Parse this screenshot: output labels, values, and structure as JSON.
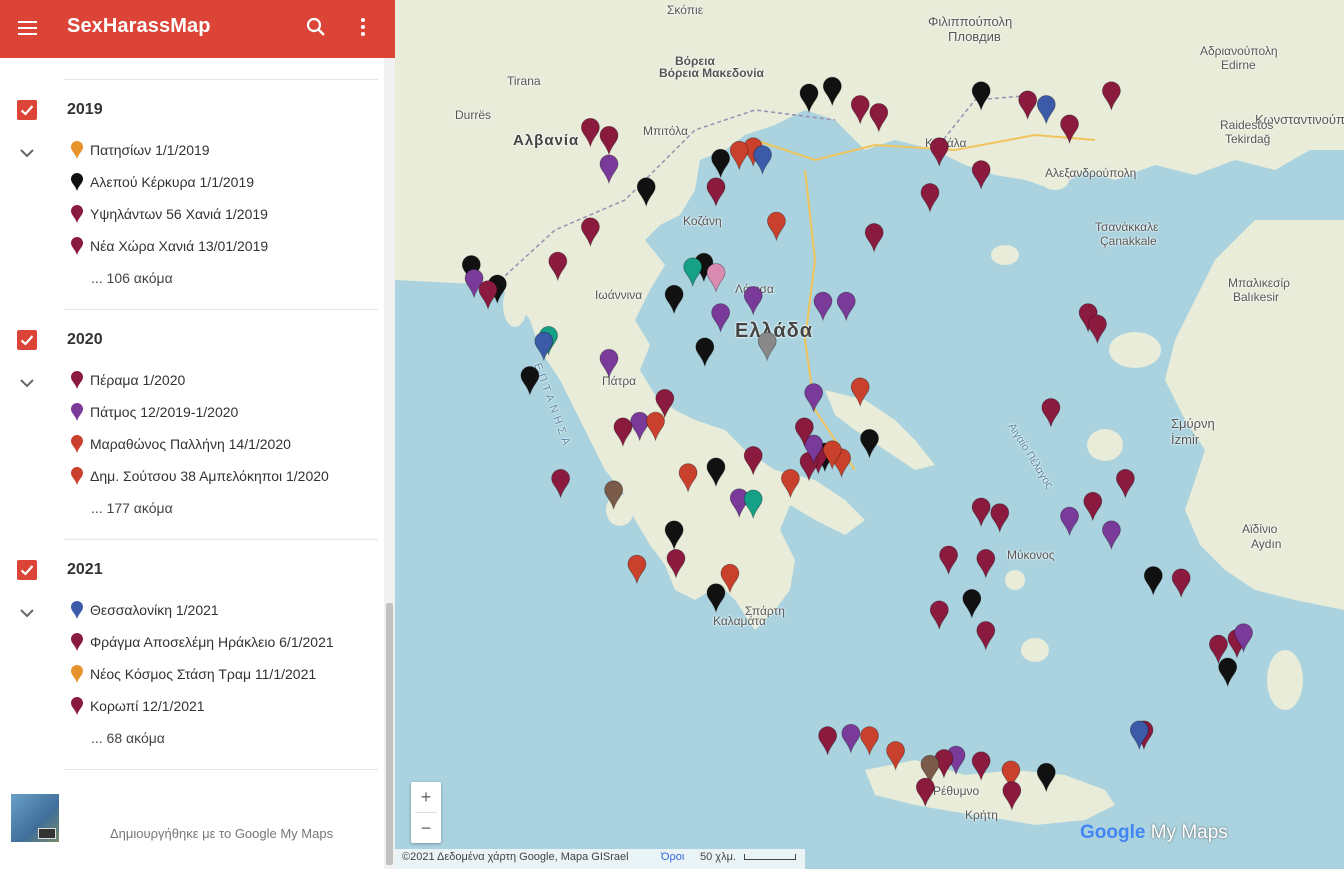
{
  "app": {
    "title": "SexHarassMap"
  },
  "icons": {
    "menu": "menu-icon",
    "search": "search-icon",
    "more": "more-vert-icon"
  },
  "colors": {
    "header": "#db4437",
    "water": "#aad3df",
    "land": "#e8ecd9"
  },
  "layers": [
    {
      "title": "2019",
      "items": [
        {
          "label": "Πατησίων 1/1/2019",
          "color": "#e8922c"
        },
        {
          "label": "Αλεπού Κέρκυρα 1/1/2019",
          "color": "#111111"
        },
        {
          "label": "Υψηλάντων 56  Χανιά  1/2019",
          "color": "#8b1a3f"
        },
        {
          "label": "Νέα Χώρα Χανιά 13/01/2019",
          "color": "#8b1a3f"
        }
      ],
      "more": "... 106 ακόμα"
    },
    {
      "title": "2020",
      "items": [
        {
          "label": "Πέραμα 1/2020",
          "color": "#8b1a3f"
        },
        {
          "label": "Πάτμος 12/2019-1/2020",
          "color": "#7a3a9a"
        },
        {
          "label": "Μαραθώνος Παλλήνη 14/1/2020",
          "color": "#c9412c"
        },
        {
          "label": "Δημ. Σούτσου 38 Αμπελόκηποι 1/2020",
          "color": "#c9412c"
        }
      ],
      "more": "... 177 ακόμα"
    },
    {
      "title": "2021",
      "items": [
        {
          "label": "Θεσσαλονίκη 1/2021",
          "color": "#3b5ba8"
        },
        {
          "label": "Φράγμα Αποσελέμη Ηράκλειο 6/1/2021",
          "color": "#8b1a3f"
        },
        {
          "label": "Νέος Κόσμος Στάση Τραμ 11/1/2021",
          "color": "#e8922c"
        },
        {
          "label": "Κορωπί 12/1/2021",
          "color": "#8b1a3f"
        }
      ],
      "more": "... 68 ακόμα"
    }
  ],
  "footer": {
    "credit": "Δημιουργήθηκε με το Google My Maps"
  },
  "map": {
    "labels": [
      {
        "text": "Σκόπιε"
      },
      {
        "text": "Βόρεια Μακεδονία"
      },
      {
        "text": "Tirana"
      },
      {
        "text": "Αλβανία"
      },
      {
        "text": "Durrës"
      },
      {
        "text": "Φιλιππούπολη"
      },
      {
        "text": "Пловдив"
      },
      {
        "text": "Αδριανούπολη"
      },
      {
        "text": "Edirne"
      },
      {
        "text": "Κωνσταντινούπολη"
      },
      {
        "text": "Raidestos"
      },
      {
        "text": "Tekirdağ"
      },
      {
        "text": "Αλεξανδρούπολη"
      },
      {
        "text": "Τσανάκκαλε"
      },
      {
        "text": "Çanakkale"
      },
      {
        "text": "Μπαλικεσίρ"
      },
      {
        "text": "Balıkesir"
      },
      {
        "text": "Σμύρνη"
      },
      {
        "text": "İzmir"
      },
      {
        "text": "Ελλάδα"
      },
      {
        "text": "Αιγαίο Πέλαγος"
      },
      {
        "text": "ΕΠΤΑΝΗΣΑ"
      },
      {
        "text": "Καβάλα"
      },
      {
        "text": "Κοζάνη"
      },
      {
        "text": "Ιωάννινα"
      },
      {
        "text": "Λάρισα"
      },
      {
        "text": "Πάτρα"
      },
      {
        "text": "Καλαμάτα"
      },
      {
        "text": "Μύκονος"
      },
      {
        "text": "Ρέθυμνο"
      },
      {
        "text": "Κρήτη"
      },
      {
        "text": "Αϊδίνιο"
      },
      {
        "text": "Aydın"
      },
      {
        "text": "Μπιτόλα"
      },
      {
        "text": "Βόρεια"
      },
      {
        "text": "Σπάρτη"
      }
    ],
    "zoom_in": "+",
    "zoom_out": "−",
    "brand_google": "Google",
    "brand_mymaps": "My Maps",
    "attribution": "©2021 Δεδομένα χάρτη Google, Mapa GISrael",
    "terms": "Όροι",
    "scale": "50 χλμ."
  },
  "pins": [
    {
      "lat": 41.12,
      "lon": 23.55,
      "c": "#111111"
    },
    {
      "lat": 41.18,
      "lon": 23.8,
      "c": "#111111"
    },
    {
      "lat": 41.02,
      "lon": 24.1,
      "c": "#8b1a3f"
    },
    {
      "lat": 40.95,
      "lon": 24.3,
      "c": "#8b1a3f"
    },
    {
      "lat": 41.14,
      "lon": 25.4,
      "c": "#111111"
    },
    {
      "lat": 41.06,
      "lon": 25.9,
      "c": "#8b1a3f"
    },
    {
      "lat": 41.02,
      "lon": 26.1,
      "c": "#3b5ba8"
    },
    {
      "lat": 40.85,
      "lon": 26.35,
      "c": "#8b1a3f"
    },
    {
      "lat": 41.14,
      "lon": 26.8,
      "c": "#8b1a3f"
    },
    {
      "lat": 40.65,
      "lon": 24.95,
      "c": "#8b1a3f"
    },
    {
      "lat": 40.45,
      "lon": 25.4,
      "c": "#8b1a3f"
    },
    {
      "lat": 40.65,
      "lon": 22.95,
      "c": "#c9412c"
    },
    {
      "lat": 40.62,
      "lon": 22.8,
      "c": "#c9412c"
    },
    {
      "lat": 40.58,
      "lon": 23.05,
      "c": "#3b5ba8"
    },
    {
      "lat": 40.55,
      "lon": 22.6,
      "c": "#111111"
    },
    {
      "lat": 40.3,
      "lon": 22.55,
      "c": "#8b1a3f"
    },
    {
      "lat": 40.3,
      "lon": 21.8,
      "c": "#111111"
    },
    {
      "lat": 40.5,
      "lon": 21.4,
      "c": "#7a3a9a"
    },
    {
      "lat": 40.82,
      "lon": 21.2,
      "c": "#8b1a3f"
    },
    {
      "lat": 40.75,
      "lon": 21.4,
      "c": "#8b1a3f"
    },
    {
      "lat": 39.95,
      "lon": 21.2,
      "c": "#8b1a3f"
    },
    {
      "lat": 39.65,
      "lon": 20.85,
      "c": "#8b1a3f"
    },
    {
      "lat": 39.62,
      "lon": 19.92,
      "c": "#111111"
    },
    {
      "lat": 39.5,
      "lon": 19.95,
      "c": "#7a3a9a"
    },
    {
      "lat": 39.45,
      "lon": 20.2,
      "c": "#111111"
    },
    {
      "lat": 39.4,
      "lon": 20.1,
      "c": "#8b1a3f"
    },
    {
      "lat": 39.64,
      "lon": 22.42,
      "c": "#111111"
    },
    {
      "lat": 39.6,
      "lon": 22.3,
      "c": "#16a085"
    },
    {
      "lat": 39.55,
      "lon": 22.55,
      "c": "#d98bb0"
    },
    {
      "lat": 39.35,
      "lon": 22.95,
      "c": "#7a3a9a"
    },
    {
      "lat": 39.36,
      "lon": 22.1,
      "c": "#111111"
    },
    {
      "lat": 39.2,
      "lon": 22.6,
      "c": "#7a3a9a"
    },
    {
      "lat": 39.0,
      "lon": 20.75,
      "c": "#16a085"
    },
    {
      "lat": 38.95,
      "lon": 20.7,
      "c": "#3b5ba8"
    },
    {
      "lat": 38.9,
      "lon": 22.43,
      "c": "#111111"
    },
    {
      "lat": 38.95,
      "lon": 23.1,
      "c": "#888888"
    },
    {
      "lat": 38.8,
      "lon": 21.4,
      "c": "#7a3a9a"
    },
    {
      "lat": 38.65,
      "lon": 20.55,
      "c": "#111111"
    },
    {
      "lat": 38.25,
      "lon": 21.73,
      "c": "#7a3a9a"
    },
    {
      "lat": 38.25,
      "lon": 21.9,
      "c": "#c9412c"
    },
    {
      "lat": 38.2,
      "lon": 21.55,
      "c": "#8b1a3f"
    },
    {
      "lat": 37.95,
      "lon": 22.95,
      "c": "#8b1a3f"
    },
    {
      "lat": 37.98,
      "lon": 23.72,
      "c": "#111111"
    },
    {
      "lat": 37.96,
      "lon": 23.65,
      "c": "#8b1a3f"
    },
    {
      "lat": 37.93,
      "lon": 23.9,
      "c": "#c9412c"
    },
    {
      "lat": 38.0,
      "lon": 23.8,
      "c": "#c9412c"
    },
    {
      "lat": 37.9,
      "lon": 23.55,
      "c": "#8b1a3f"
    },
    {
      "lat": 38.05,
      "lon": 23.6,
      "c": "#7a3a9a"
    },
    {
      "lat": 38.2,
      "lon": 23.5,
      "c": "#8b1a3f"
    },
    {
      "lat": 37.75,
      "lon": 23.35,
      "c": "#c9412c"
    },
    {
      "lat": 37.85,
      "lon": 22.55,
      "c": "#111111"
    },
    {
      "lat": 37.8,
      "lon": 22.25,
      "c": "#c9412c"
    },
    {
      "lat": 37.65,
      "lon": 21.45,
      "c": "#7a5a48"
    },
    {
      "lat": 37.75,
      "lon": 20.88,
      "c": "#8b1a3f"
    },
    {
      "lat": 37.58,
      "lon": 22.8,
      "c": "#7a3a9a"
    },
    {
      "lat": 37.57,
      "lon": 22.95,
      "c": "#16a085"
    },
    {
      "lat": 37.3,
      "lon": 22.1,
      "c": "#111111"
    },
    {
      "lat": 37.05,
      "lon": 22.12,
      "c": "#8b1a3f"
    },
    {
      "lat": 37.0,
      "lon": 21.7,
      "c": "#c9412c"
    },
    {
      "lat": 36.92,
      "lon": 22.7,
      "c": "#c9412c"
    },
    {
      "lat": 36.75,
      "lon": 22.55,
      "c": "#111111"
    },
    {
      "lat": 38.45,
      "lon": 22.0,
      "c": "#8b1a3f"
    },
    {
      "lat": 38.5,
      "lon": 23.6,
      "c": "#7a3a9a"
    },
    {
      "lat": 38.55,
      "lon": 24.1,
      "c": "#c9412c"
    },
    {
      "lat": 39.3,
      "lon": 23.7,
      "c": "#7a3a9a"
    },
    {
      "lat": 39.3,
      "lon": 23.95,
      "c": "#7a3a9a"
    },
    {
      "lat": 40.25,
      "lon": 24.85,
      "c": "#8b1a3f"
    },
    {
      "lat": 40.0,
      "lon": 23.2,
      "c": "#c9412c"
    },
    {
      "lat": 39.2,
      "lon": 26.55,
      "c": "#8b1a3f"
    },
    {
      "lat": 39.1,
      "lon": 26.65,
      "c": "#8b1a3f"
    },
    {
      "lat": 38.37,
      "lon": 26.15,
      "c": "#8b1a3f"
    },
    {
      "lat": 37.75,
      "lon": 26.95,
      "c": "#8b1a3f"
    },
    {
      "lat": 37.55,
      "lon": 26.6,
      "c": "#8b1a3f"
    },
    {
      "lat": 37.42,
      "lon": 26.35,
      "c": "#7a3a9a"
    },
    {
      "lat": 37.3,
      "lon": 26.8,
      "c": "#7a3a9a"
    },
    {
      "lat": 36.9,
      "lon": 27.25,
      "c": "#111111"
    },
    {
      "lat": 36.88,
      "lon": 27.55,
      "c": "#8b1a3f"
    },
    {
      "lat": 37.5,
      "lon": 25.4,
      "c": "#8b1a3f"
    },
    {
      "lat": 37.45,
      "lon": 25.6,
      "c": "#8b1a3f"
    },
    {
      "lat": 37.08,
      "lon": 25.05,
      "c": "#8b1a3f"
    },
    {
      "lat": 37.05,
      "lon": 25.45,
      "c": "#8b1a3f"
    },
    {
      "lat": 36.7,
      "lon": 25.3,
      "c": "#111111"
    },
    {
      "lat": 36.6,
      "lon": 24.95,
      "c": "#8b1a3f"
    },
    {
      "lat": 36.42,
      "lon": 25.45,
      "c": "#8b1a3f"
    },
    {
      "lat": 36.35,
      "lon": 28.15,
      "c": "#8b1a3f"
    },
    {
      "lat": 36.4,
      "lon": 28.22,
      "c": "#7a3a9a"
    },
    {
      "lat": 36.1,
      "lon": 28.05,
      "c": "#111111"
    },
    {
      "lat": 36.3,
      "lon": 27.95,
      "c": "#8b1a3f"
    },
    {
      "lat": 35.52,
      "lon": 24.0,
      "c": "#7a3a9a"
    },
    {
      "lat": 35.5,
      "lon": 23.75,
      "c": "#8b1a3f"
    },
    {
      "lat": 35.5,
      "lon": 24.2,
      "c": "#c9412c"
    },
    {
      "lat": 35.37,
      "lon": 24.48,
      "c": "#c9412c"
    },
    {
      "lat": 35.33,
      "lon": 25.13,
      "c": "#7a3a9a"
    },
    {
      "lat": 35.3,
      "lon": 25.0,
      "c": "#8b1a3f"
    },
    {
      "lat": 35.28,
      "lon": 25.4,
      "c": "#8b1a3f"
    },
    {
      "lat": 35.2,
      "lon": 25.72,
      "c": "#c9412c"
    },
    {
      "lat": 35.18,
      "lon": 26.1,
      "c": "#111111"
    },
    {
      "lat": 35.25,
      "lon": 24.85,
      "c": "#7a5a48"
    },
    {
      "lat": 35.05,
      "lon": 24.8,
      "c": "#8b1a3f"
    },
    {
      "lat": 35.02,
      "lon": 25.73,
      "c": "#8b1a3f"
    },
    {
      "lat": 35.55,
      "lon": 27.15,
      "c": "#8b1a3f"
    },
    {
      "lat": 35.55,
      "lon": 27.1,
      "c": "#3b5ba8"
    },
    {
      "lat": 39.9,
      "lon": 24.25,
      "c": "#8b1a3f"
    },
    {
      "lat": 38.1,
      "lon": 24.2,
      "c": "#111111"
    }
  ]
}
